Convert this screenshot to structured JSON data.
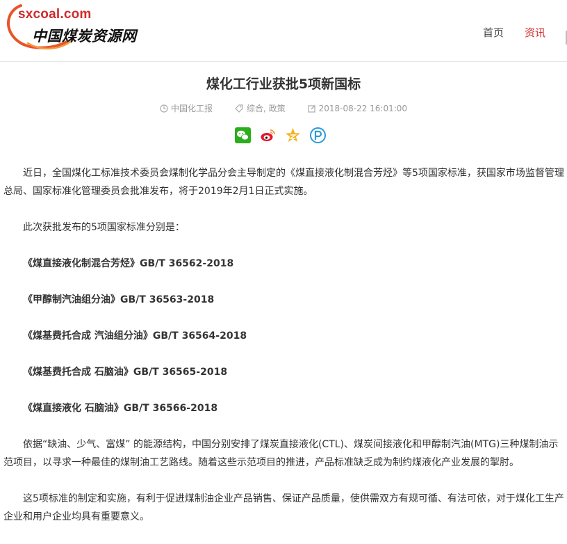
{
  "header": {
    "logo_domain": "sxcoal.com",
    "logo_name": "中国煤炭资源网",
    "nav": [
      {
        "label": "首页",
        "active": false
      },
      {
        "label": "资讯",
        "active": true
      }
    ]
  },
  "article": {
    "title": "煤化工行业获批5项新国标",
    "meta": {
      "source": "中国化工报",
      "tags": "综合, 政策",
      "datetime": "2018-08-22 16:01:00"
    },
    "share": [
      {
        "icon": "wechat-icon",
        "color": "#2aae1c"
      },
      {
        "icon": "weibo-icon",
        "color": "#e6162d"
      },
      {
        "icon": "qzone-icon",
        "color": "#f6b31e"
      },
      {
        "icon": "douban-icon",
        "color": "#2b9ad8"
      }
    ],
    "paragraphs": {
      "intro": "近日，全国煤化工标准技术委员会煤制化学品分会主导制定的《煤直接液化制混合芳烃》等5项国家标准，获国家市场监督管理总局、国家标准化管理委员会批准发布，将于2019年2月1日正式实施。",
      "list_intro": "此次获批发布的5项国家标准分别是：",
      "standards": [
        "《煤直接液化制混合芳烃》GB/T 36562-2018",
        "《甲醇制汽油组分油》GB/T 36563-2018",
        "《煤基费托合成 汽油组分油》GB/T 36564-2018",
        "《煤基费托合成 石脑油》GB/T 36565-2018",
        "《煤直接液化 石脑油》GB/T 36566-2018"
      ],
      "background": "依据“缺油、少气、富煤” 的能源结构，中国分别安排了煤炭直接液化(CTL)、煤炭间接液化和甲醇制汽油(MTG)三种煤制油示范项目，以寻求一种最佳的煤制油工艺路线。随着这些示范项目的推进，产品标准缺乏成为制约煤液化产业发展的掣肘。",
      "significance": "这5项标准的制定和实施，有利于促进煤制油企业产品销售、保证产品质量，使供需双方有规可循、有法可依，对于煤化工生产企业和用户企业均具有重要意义。"
    }
  }
}
